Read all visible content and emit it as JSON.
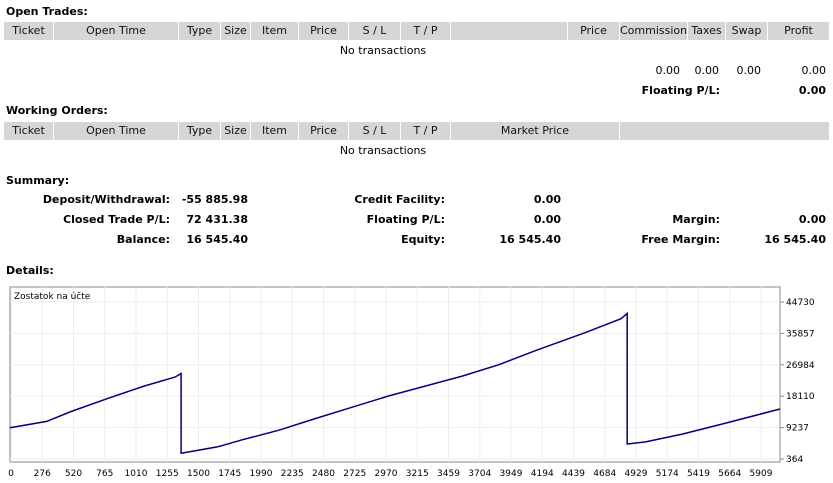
{
  "open_trades": {
    "title": "Open Trades:",
    "columns": [
      "Ticket",
      "Open Time",
      "Type",
      "Size",
      "Item",
      "Price",
      "S / L",
      "T / P",
      "",
      "Price",
      "Commission",
      "Taxes",
      "Swap",
      "Profit"
    ],
    "empty_text": "No transactions",
    "totals": {
      "commission": "0.00",
      "taxes": "0.00",
      "swap": "0.00",
      "profit": "0.00"
    },
    "floating_label": "Floating P/L:",
    "floating_value": "0.00"
  },
  "working_orders": {
    "title": "Working Orders:",
    "columns": [
      "Ticket",
      "Open Time",
      "Type",
      "Size",
      "Item",
      "Price",
      "S / L",
      "T / P",
      "Market Price",
      ""
    ],
    "empty_text": "No transactions"
  },
  "summary": {
    "title": "Summary:",
    "deposit_label": "Deposit/Withdrawal:",
    "deposit_value": "-55 885.98",
    "closed_label": "Closed Trade P/L:",
    "closed_value": "72 431.38",
    "balance_label": "Balance:",
    "balance_value": "16 545.40",
    "credit_label": "Credit Facility:",
    "credit_value": "0.00",
    "floating_label": "Floating P/L:",
    "floating_value": "0.00",
    "equity_label": "Equity:",
    "equity_value": "16 545.40",
    "margin_label": "Margin:",
    "margin_value": "0.00",
    "free_margin_label": "Free Margin:",
    "free_margin_value": "16 545.40"
  },
  "details": {
    "title": "Details:"
  },
  "chart_data": {
    "type": "line",
    "title": "Zostatok na účte",
    "line_color": "#000080",
    "x_ticks": [
      "0",
      "276",
      "520",
      "765",
      "1010",
      "1255",
      "1500",
      "1745",
      "1990",
      "2235",
      "2480",
      "2725",
      "2970",
      "3215",
      "3459",
      "3704",
      "3949",
      "4194",
      "4439",
      "4684",
      "4929",
      "5174",
      "5419",
      "5664",
      "5909"
    ],
    "y_ticks": [
      "44730",
      "35857",
      "26984",
      "18110",
      "9237",
      "364"
    ],
    "ylim": [
      364,
      44730
    ],
    "xlim": [
      0,
      6300
    ],
    "series": [
      {
        "x": [
          0,
          300,
          500,
          800,
          1100,
          1350,
          1400,
          1400,
          1500,
          1700,
          1900,
          2200,
          2500,
          2800,
          3100,
          3400,
          3700,
          4000,
          4300,
          4700,
          5000,
          5050,
          5050,
          5200,
          5500,
          5800,
          6300
        ],
        "values": [
          9200,
          11000,
          13800,
          17500,
          21000,
          23500,
          24500,
          2000,
          2600,
          3800,
          5800,
          8500,
          11800,
          15000,
          18200,
          21000,
          23800,
          27000,
          31000,
          36000,
          40000,
          41500,
          4600,
          5200,
          7400,
          10000,
          14500
        ]
      }
    ]
  }
}
